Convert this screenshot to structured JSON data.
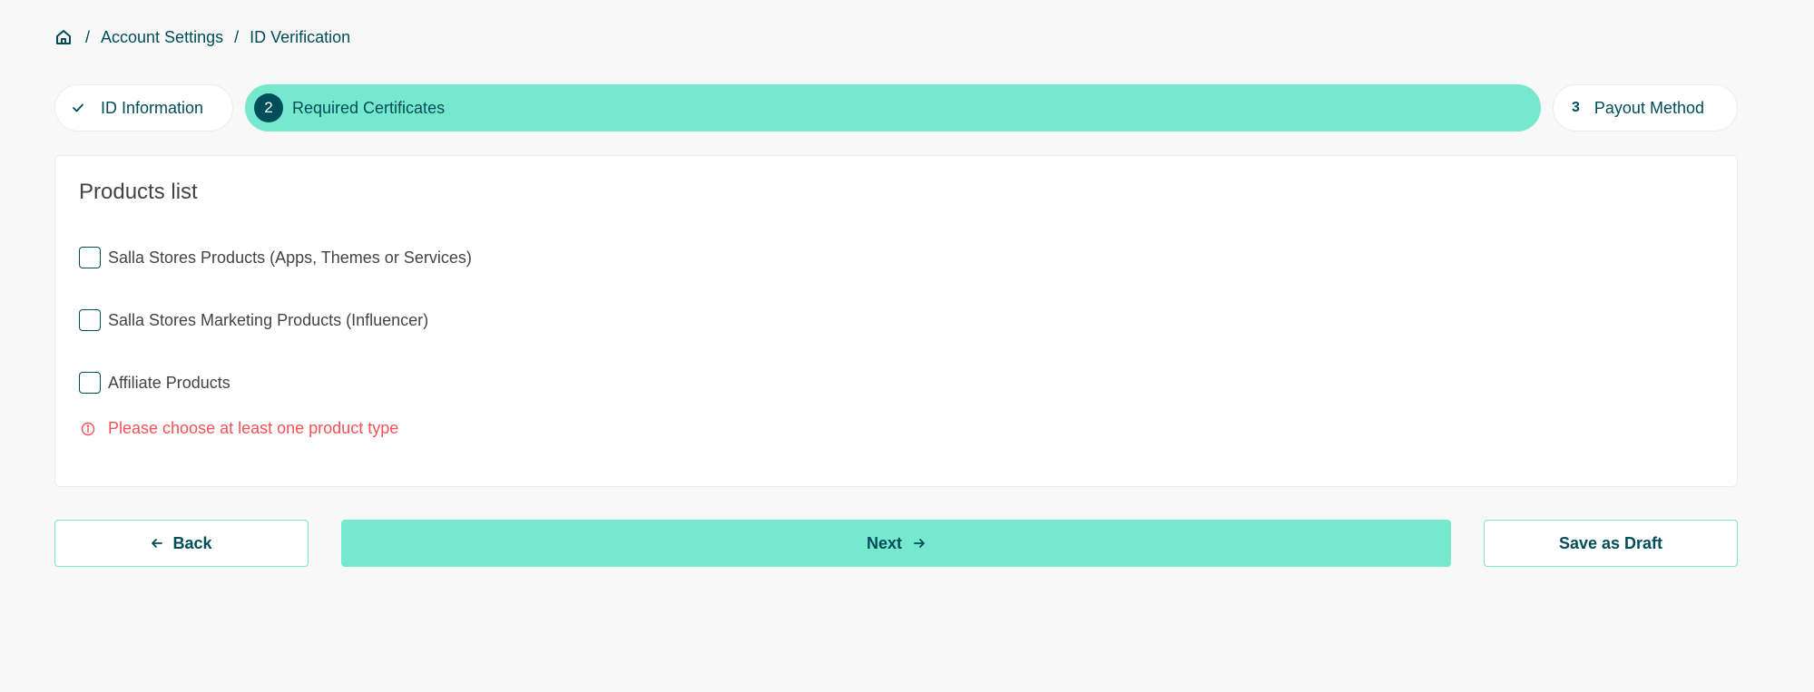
{
  "breadcrumb": {
    "items": [
      "Account Settings",
      "ID Verification"
    ],
    "separator": "/"
  },
  "stepper": {
    "steps": [
      {
        "number": "",
        "label": "ID Information",
        "status": "completed"
      },
      {
        "number": "2",
        "label": "Required Certificates",
        "status": "active"
      },
      {
        "number": "3",
        "label": "Payout Method",
        "status": "upcoming"
      }
    ]
  },
  "products": {
    "title": "Products list",
    "options": [
      {
        "label": "Salla Stores Products (Apps, Themes or Services)",
        "checked": false
      },
      {
        "label": "Salla Stores Marketing Products (Influencer)",
        "checked": false
      },
      {
        "label": "Affiliate Products",
        "checked": false
      }
    ],
    "error": "Please choose at least one product type"
  },
  "actions": {
    "back_label": "Back",
    "next_label": "Next",
    "draft_label": "Save as Draft"
  },
  "colors": {
    "accent": "#76e8cd",
    "primary": "#004d5a",
    "error": "#f55157",
    "background": "#f8f8f8"
  },
  "icons": {
    "home": "home-icon",
    "check": "check-icon",
    "info": "info-icon",
    "arrow_left": "arrow-left-icon",
    "arrow_right": "arrow-right-icon"
  }
}
